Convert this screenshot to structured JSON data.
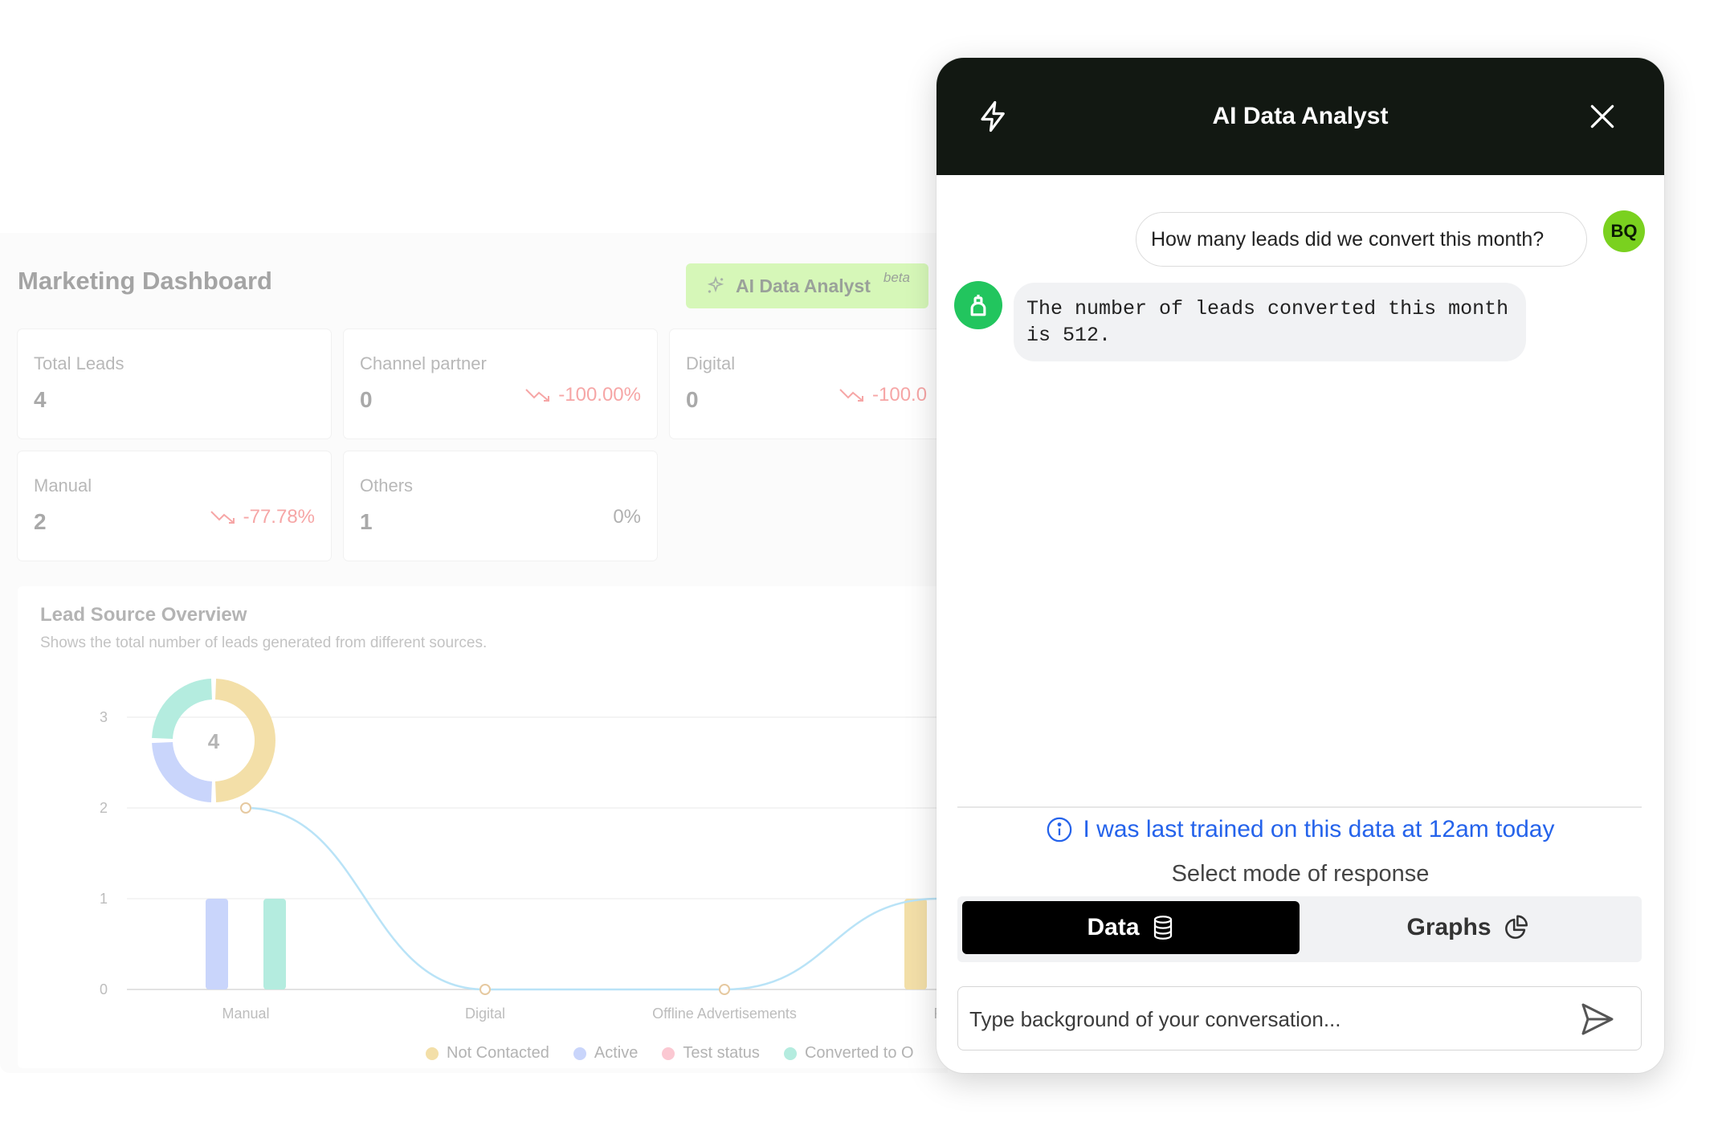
{
  "dashboard": {
    "title": "Marketing Dashboard",
    "ai_button": {
      "label": "AI Data Analyst",
      "badge": "beta"
    },
    "cards": [
      {
        "label": "Total Leads",
        "value": "4",
        "change": ""
      },
      {
        "label": "Channel partner",
        "value": "0",
        "change": "-100.00%"
      },
      {
        "label": "Digital",
        "value": "0",
        "change": "-100.0"
      },
      {
        "label": "Manual",
        "value": "2",
        "change": "-77.78%"
      },
      {
        "label": "Others",
        "value": "1",
        "change": "0%"
      }
    ],
    "lead_source": {
      "title": "Lead Source Overview",
      "subtitle": "Shows the total number of leads generated from different sources.",
      "donut_total": "4"
    }
  },
  "chart_data": {
    "type": "bar",
    "categories": [
      "Manual",
      "Digital",
      "Offline Advertisements",
      "F"
    ],
    "y_ticks": [
      "0",
      "1",
      "2",
      "3"
    ],
    "ylim": [
      0,
      3
    ],
    "series": [
      {
        "name": "Not Contacted",
        "values": [
          0,
          0,
          0,
          1
        ]
      },
      {
        "name": "Active",
        "values": [
          1,
          0,
          0,
          0
        ]
      },
      {
        "name": "Test status",
        "values": [
          0,
          0,
          0,
          0
        ]
      },
      {
        "name": "Converted to O",
        "values": [
          1,
          0,
          0,
          0
        ]
      }
    ],
    "line_values": [
      2,
      0,
      0,
      1
    ],
    "donut": {
      "total": 4,
      "segments": [
        2,
        1,
        1
      ]
    },
    "legend_position": "bottom",
    "colors": {
      "Not Contacted": "#f3dfa8",
      "Active": "#c9d5fb",
      "Test status": "#fbc8d2",
      "Converted to O": "#b4ecdf"
    }
  },
  "chat": {
    "title": "AI Data Analyst",
    "header_icon": "bolt-icon",
    "close_icon": "close-icon",
    "messages": [
      {
        "role": "user",
        "avatar": "BQ",
        "text": "How many leads did we convert this month?"
      },
      {
        "role": "bot",
        "avatar": "bot-icon",
        "text": "The number of leads converted this month is 512."
      }
    ],
    "trained_notice": "I was last trained on this data at 12am today",
    "select_mode_label": "Select mode of response",
    "modes": {
      "data": "Data",
      "graphs": "Graphs",
      "active": "Data"
    },
    "input_placeholder": "Type background of your conversation...",
    "accent": "#2563eb"
  }
}
